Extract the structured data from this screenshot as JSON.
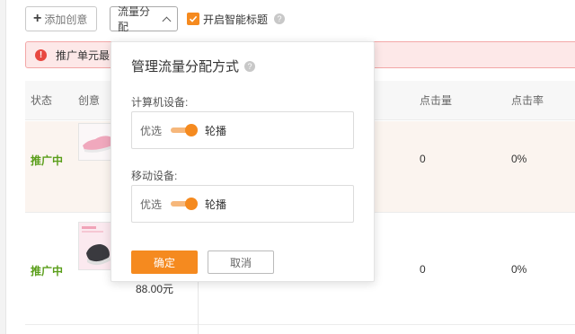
{
  "toolbar": {
    "add_plus": "+",
    "add_label": "添加创意",
    "traffic_label": "流量分配",
    "smart_title_label": "开启智能标题",
    "help_glyph": "?"
  },
  "alert": {
    "icon_glyph": "!",
    "text": "推广单元最多"
  },
  "table": {
    "headers": {
      "status": "状态",
      "creative": "创意",
      "clicks": "点击量",
      "ctr": "点击率"
    },
    "rows": [
      {
        "status": "推广中",
        "clicks": "0",
        "ctr": "0%",
        "price": ""
      },
      {
        "status": "推广中",
        "clicks": "0",
        "ctr": "0%",
        "price": "88.00元"
      }
    ]
  },
  "popover": {
    "title": "管理流量分配方式",
    "help_glyph": "?",
    "sections": [
      {
        "label": "计算机设备:",
        "left_option": "优选",
        "right_option": "轮播"
      },
      {
        "label": "移动设备:",
        "left_option": "优选",
        "right_option": "轮播"
      }
    ],
    "confirm_label": "确定",
    "cancel_label": "取消"
  },
  "colors": {
    "accent": "#f58a1f",
    "status_green": "#5a9e1a",
    "alert_bg": "#fde8e8",
    "alert_border": "#f3a7a7",
    "alert_icon": "#e8473f"
  },
  "icons": {
    "checkbox": "checkbox-checked-icon",
    "chevron": "chevron-up-icon",
    "alert": "error-circle-icon"
  }
}
